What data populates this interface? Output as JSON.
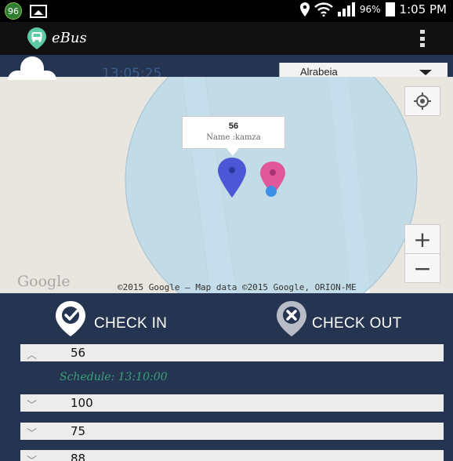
{
  "statusbar": {
    "badge": "96",
    "battery": "96%",
    "time": "1:05 PM"
  },
  "appbar": {
    "title": "eBus"
  },
  "infobar": {
    "time": "13:05:25",
    "station_selected": "Alrabeia"
  },
  "map": {
    "google_logo": "Google",
    "copyright": "©2015 Google – Map data ©2015 Google, ORION-ME",
    "zoom_in": "+",
    "zoom_out": "−",
    "info_window": {
      "title": "56",
      "subtitle": "Name :kamza"
    }
  },
  "actions": {
    "check_in": "CHECK IN",
    "check_out": "CHECK OUT"
  },
  "routes": [
    {
      "number": "56",
      "expanded": true,
      "schedule": "Schedule: 13:10:00"
    },
    {
      "number": "100",
      "expanded": false
    },
    {
      "number": "75",
      "expanded": false
    },
    {
      "number": "88",
      "expanded": false
    }
  ],
  "colors": {
    "primary_navy": "#253450",
    "bus_marker": "#4b57d6",
    "user_marker": "#e0579a",
    "schedule_text": "#3aa17a"
  }
}
